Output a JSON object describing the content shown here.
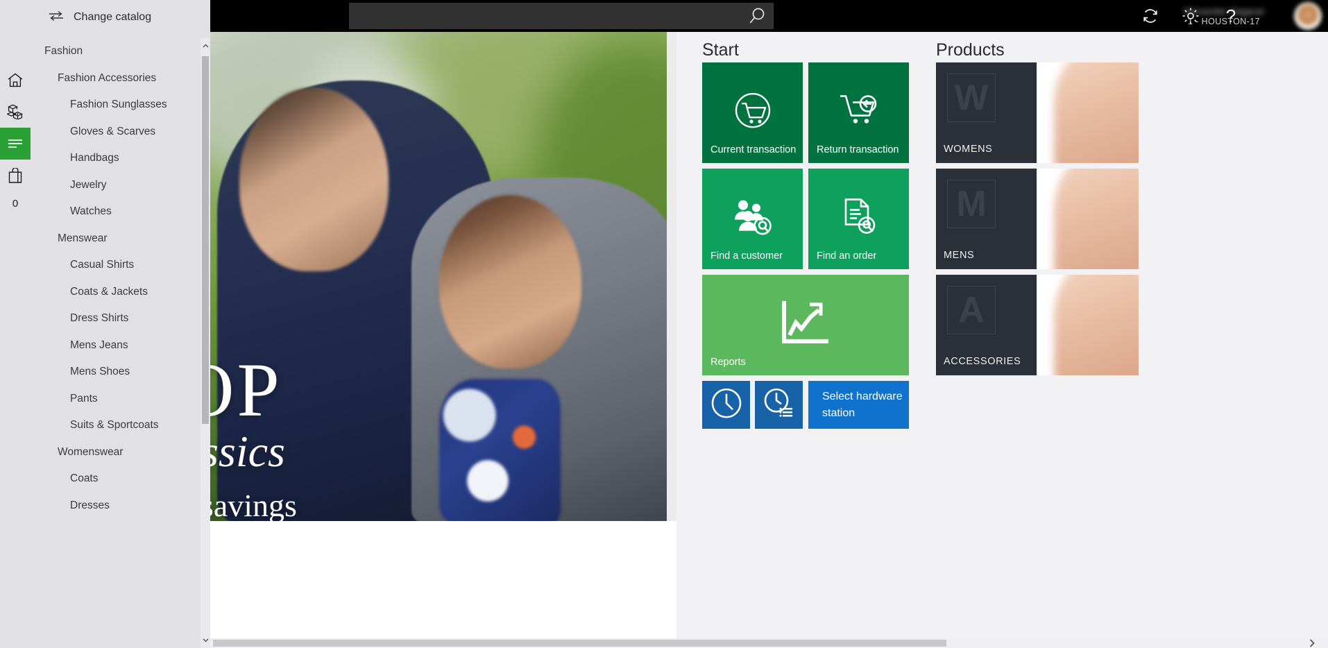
{
  "nav": {
    "hamburger_icon": "hamburger-icon",
    "change_catalog_label": "Change catalog",
    "change_catalog_icon": "swap-arrows-icon",
    "rail_items": [
      {
        "icon": "home-icon",
        "name": "home",
        "active": false
      },
      {
        "icon": "inventory-boxes-icon",
        "name": "inventory",
        "active": false
      },
      {
        "icon": "catalog-lines-icon",
        "name": "catalog",
        "active": true
      },
      {
        "icon": "shopping-bag-icon",
        "name": "cart",
        "active": false
      }
    ],
    "cart_count": "0"
  },
  "catalog": {
    "items": [
      {
        "label": "Fashion",
        "level": 0
      },
      {
        "label": "Fashion Accessories",
        "level": 1
      },
      {
        "label": "Fashion Sunglasses",
        "level": 2
      },
      {
        "label": "Gloves & Scarves",
        "level": 2
      },
      {
        "label": "Handbags",
        "level": 2
      },
      {
        "label": "Jewelry",
        "level": 2
      },
      {
        "label": "Watches",
        "level": 2
      },
      {
        "label": "Menswear",
        "level": 1
      },
      {
        "label": "Casual Shirts",
        "level": 2
      },
      {
        "label": "Coats & Jackets",
        "level": 2
      },
      {
        "label": "Dress Shirts",
        "level": 2
      },
      {
        "label": "Mens Jeans",
        "level": 2
      },
      {
        "label": "Mens Shoes",
        "level": 2
      },
      {
        "label": "Pants",
        "level": 2
      },
      {
        "label": "Suits & Sportcoats",
        "level": 2
      },
      {
        "label": "Womenswear",
        "level": 1
      },
      {
        "label": "Coats",
        "level": 2
      },
      {
        "label": "Dresses",
        "level": 2
      }
    ],
    "scroll_up_icon": "chevron-up-icon",
    "scroll_down_icon": "chevron-down-icon"
  },
  "topbar": {
    "search": {
      "value": "",
      "placeholder": "",
      "icon": "search-icon"
    },
    "icons": [
      {
        "name": "refresh-icon"
      },
      {
        "name": "gear-icon"
      },
      {
        "name": "help-question-icon"
      }
    ],
    "user_name": "Alexander Sagaral",
    "user_store": "1 - HOUSTON-17",
    "avatar_icon": "user-avatar"
  },
  "banner": {
    "line1": "OP",
    "line2": "assics",
    "line3": "e savings"
  },
  "start": {
    "title": "Start",
    "tiles": [
      {
        "label": "Current transaction",
        "icon": "cart-circle-icon",
        "color": "#00723f"
      },
      {
        "label": "Return transaction",
        "icon": "cart-return-icon",
        "color": "#00723f"
      },
      {
        "label": "Find a customer",
        "icon": "customer-search-icon",
        "color": "#0ea05d"
      },
      {
        "label": "Find an order",
        "icon": "order-search-icon",
        "color": "#0ea05d"
      },
      {
        "label": "Reports",
        "icon": "chart-growth-icon",
        "color": "#5cb85c"
      },
      {
        "label": "",
        "icon": "clock-icon",
        "color": "#1863a8"
      },
      {
        "label": "",
        "icon": "clock-list-icon",
        "color": "#1863a8"
      },
      {
        "label": "Select hardware station",
        "icon": "",
        "color": "#0f73ce"
      }
    ]
  },
  "products": {
    "title": "Products",
    "tiles": [
      {
        "label": "WOMENS",
        "placeholder_letter": "W",
        "color": "#2b3038"
      },
      {
        "label": "MENS",
        "placeholder_letter": "M",
        "color": "#2b3038"
      },
      {
        "label": "ACCESSORIES",
        "placeholder_letter": "A",
        "color": "#2b3038"
      }
    ],
    "more_icon": "chevron-right-icon"
  },
  "scrollbars": {
    "h_next_icon": "chevron-right-icon"
  },
  "colors": {
    "accent_green": "#2aa134",
    "tile_dark_green": "#00723f",
    "tile_green": "#0ea05d",
    "tile_light_green": "#5cb85c",
    "tile_dark_blue": "#1863a8",
    "tile_blue": "#0f73ce",
    "rail_bg": "#e1e1e3",
    "dash_bg": "#f2f2f4",
    "topbar_bg": "#000000",
    "product_tile": "#2b3038"
  }
}
